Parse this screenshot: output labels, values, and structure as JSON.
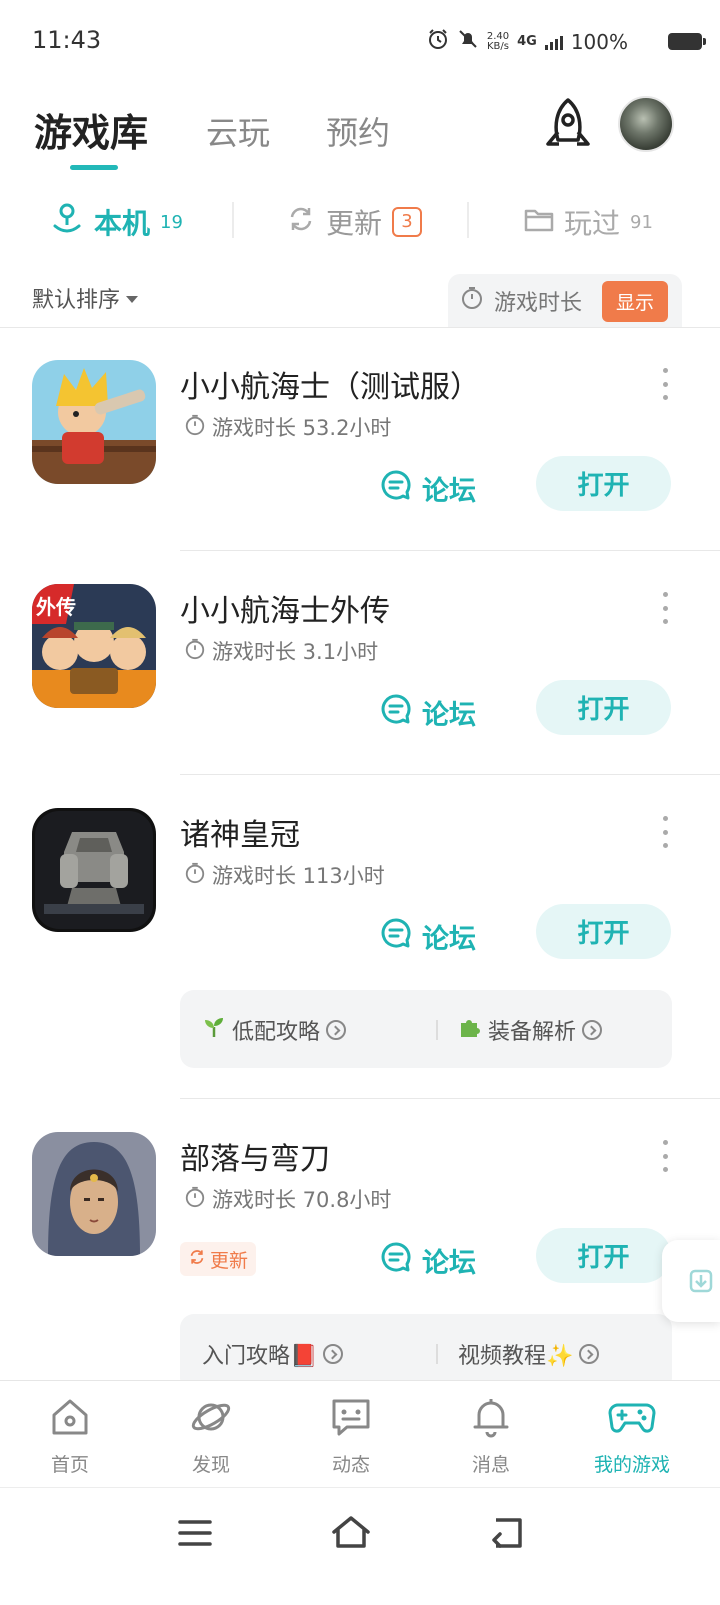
{
  "status_bar": {
    "time": "11:43",
    "net_speed_value": "2.40",
    "net_speed_unit": "KB/s",
    "network": "4G",
    "battery": "100%"
  },
  "header": {
    "tabs": [
      {
        "label": "游戏库",
        "active": true
      },
      {
        "label": "云玩",
        "active": false
      },
      {
        "label": "预约",
        "active": false
      }
    ]
  },
  "segments": {
    "local": {
      "label": "本机",
      "count": "19"
    },
    "update": {
      "label": "更新",
      "count": "3"
    },
    "played": {
      "label": "玩过",
      "count": "91"
    }
  },
  "sort": {
    "label": "默认排序",
    "duration_toggle_label": "游戏时长",
    "duration_toggle_state": "显示"
  },
  "games": [
    {
      "title": "小小航海士（测试服）",
      "duration": "游戏时长 53.2小时",
      "forum": "论坛",
      "open": "打开"
    },
    {
      "title": "小小航海士外传",
      "duration": "游戏时长 3.1小时",
      "forum": "论坛",
      "open": "打开"
    },
    {
      "title": "诸神皇冠",
      "duration": "游戏时长 113小时",
      "forum": "论坛",
      "open": "打开",
      "guides": [
        "低配攻略",
        "装备解析"
      ]
    },
    {
      "title": "部落与弯刀",
      "duration": "游戏时长 70.8小时",
      "forum": "论坛",
      "open": "打开",
      "update_tag": "更新",
      "guides": [
        "入门攻略📕",
        "视频教程✨"
      ]
    }
  ],
  "bottom_nav": [
    {
      "label": "首页",
      "icon": "home-icon"
    },
    {
      "label": "发现",
      "icon": "planet-icon"
    },
    {
      "label": "动态",
      "icon": "message-icon"
    },
    {
      "label": "消息",
      "icon": "bell-icon"
    },
    {
      "label": "我的游戏",
      "icon": "gamepad-icon",
      "active": true
    }
  ],
  "colors": {
    "accent": "#1fb3b3",
    "orange": "#f07b4a"
  }
}
